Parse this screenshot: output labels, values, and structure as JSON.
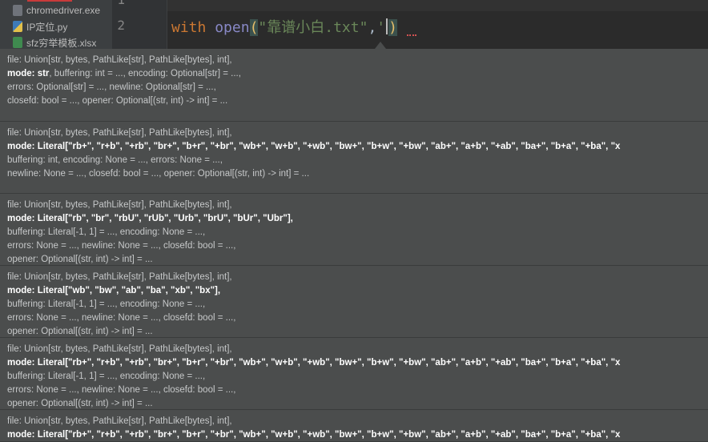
{
  "project_tree": {
    "items": [
      {
        "label": "chromedriver.exe",
        "icon": "exe-file-icon"
      },
      {
        "label": "IP定位.py",
        "icon": "python-file-icon"
      },
      {
        "label": "sfz穷举模板.xlsx",
        "icon": "excel-file-icon"
      }
    ]
  },
  "editor": {
    "line_numbers": [
      "1",
      "2"
    ],
    "code": {
      "keyword": "with",
      "function": "open",
      "open_paren": "(",
      "string": "\"靠谱小白.txt\"",
      "comma": ",",
      "quote": "'",
      "close_paren": ")"
    }
  },
  "param_info": {
    "overloads": [
      {
        "lines": [
          {
            "text": "file: Union[str, bytes, PathLike[str], PathLike[bytes], int],"
          },
          {
            "bold": "mode: str",
            "text": ", buffering: int = ..., encoding: Optional[str] = ...,"
          },
          {
            "text": "errors: Optional[str] = ..., newline: Optional[str] = ...,"
          },
          {
            "text": "closefd: bool = ..., opener: Optional[(str, int) -> int] = ..."
          }
        ]
      },
      {
        "lines": [
          {
            "text": "file: Union[str, bytes, PathLike[str], PathLike[bytes], int],"
          },
          {
            "bold": "mode: Literal[\"rb+\", \"r+b\", \"+rb\", \"br+\", \"b+r\", \"+br\", \"wb+\", \"w+b\", \"+wb\", \"bw+\", \"b+w\", \"+bw\", \"ab+\", \"a+b\", \"+ab\", \"ba+\", \"b+a\", \"+ba\", \"x",
            "text": ""
          },
          {
            "text": "buffering: int, encoding: None = ..., errors: None = ...,"
          },
          {
            "text": "newline: None = ..., closefd: bool = ..., opener: Optional[(str, int) -> int] = ..."
          }
        ]
      },
      {
        "lines": [
          {
            "text": "file: Union[str, bytes, PathLike[str], PathLike[bytes], int],"
          },
          {
            "bold": "mode: Literal[\"rb\", \"br\", \"rbU\", \"rUb\", \"Urb\", \"brU\", \"bUr\", \"Ubr\"],",
            "text": ""
          },
          {
            "text": "buffering: Literal[-1, 1] = ..., encoding: None = ...,"
          },
          {
            "text": "errors: None = ..., newline: None = ..., closefd: bool = ...,"
          },
          {
            "text": "opener: Optional[(str, int) -> int] = ..."
          }
        ]
      },
      {
        "lines": [
          {
            "text": "file: Union[str, bytes, PathLike[str], PathLike[bytes], int],"
          },
          {
            "bold": "mode: Literal[\"wb\", \"bw\", \"ab\", \"ba\", \"xb\", \"bx\"],",
            "text": ""
          },
          {
            "text": "buffering: Literal[-1, 1] = ..., encoding: None = ...,"
          },
          {
            "text": "errors: None = ..., newline: None = ..., closefd: bool = ...,"
          },
          {
            "text": "opener: Optional[(str, int) -> int] = ..."
          }
        ]
      },
      {
        "lines": [
          {
            "text": "file: Union[str, bytes, PathLike[str], PathLike[bytes], int],"
          },
          {
            "bold": "mode: Literal[\"rb+\", \"r+b\", \"+rb\", \"br+\", \"b+r\", \"+br\", \"wb+\", \"w+b\", \"+wb\", \"bw+\", \"b+w\", \"+bw\", \"ab+\", \"a+b\", \"+ab\", \"ba+\", \"b+a\", \"+ba\", \"x",
            "text": ""
          },
          {
            "text": "buffering: Literal[-1, 1] = ..., encoding: None = ...,"
          },
          {
            "text": "errors: None = ..., newline: None = ..., closefd: bool = ...,"
          },
          {
            "text": "opener: Optional[(str, int) -> int] = ..."
          }
        ]
      },
      {
        "lines": [
          {
            "text": "file: Union[str, bytes, PathLike[str], PathLike[bytes], int],"
          },
          {
            "bold": "mode: Literal[\"rb+\", \"r+b\", \"+rb\", \"br+\", \"b+r\", \"+br\", \"wb+\", \"w+b\", \"+wb\", \"bw+\", \"b+w\", \"+bw\", \"ab+\", \"a+b\", \"+ab\", \"ba+\", \"b+a\", \"+ba\", \"x",
            "text": ""
          }
        ]
      }
    ]
  }
}
